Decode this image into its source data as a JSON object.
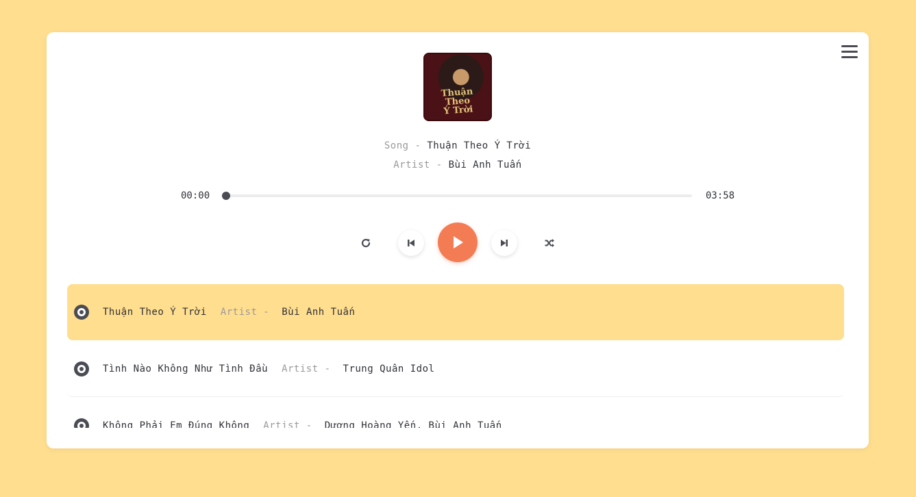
{
  "cover": {
    "caption_line1": "Thuận Theo",
    "caption_line2": "Ý Trời"
  },
  "now_playing": {
    "song_label": "Song - ",
    "song_title": "Thuận Theo Ý Trời",
    "artist_label": "Artist - ",
    "artist_name": "Bùi Anh Tuấn"
  },
  "player": {
    "current_time": "00:00",
    "duration": "03:58",
    "progress_fraction": 0,
    "accent_color": "#f47c55"
  },
  "controls": {
    "repeat_icon": "repeat-icon",
    "prev_icon": "previous-icon",
    "play_icon": "play-icon",
    "next_icon": "next-icon",
    "shuffle_icon": "shuffle-icon"
  },
  "playlist": [
    {
      "title": "Thuận Theo Ý Trời",
      "artist_label": "Artist -",
      "artist": "Bùi Anh Tuấn",
      "active": true
    },
    {
      "title": "Tình Nào Không Như Tình Đầu",
      "artist_label": "Artist -",
      "artist": "Trung Quân Idol",
      "active": false
    },
    {
      "title": "Không Phải Em Đúng Không",
      "artist_label": "Artist -",
      "artist": "Dương Hoàng Yến, Bùi Anh Tuấn",
      "active": false
    }
  ],
  "colors": {
    "background": "#ffde8f",
    "card": "#ffffff",
    "active_row": "#ffde8f"
  }
}
